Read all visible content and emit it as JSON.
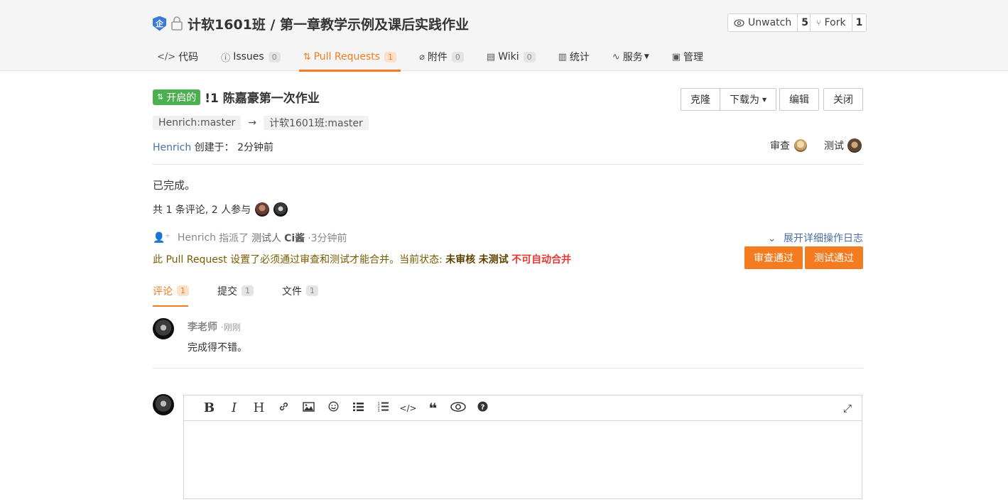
{
  "repo": {
    "badge": "企",
    "title": "计软1601班 / 第一章教学示例及课后实践作业",
    "watch": {
      "label": "Unwatch",
      "count": "5"
    },
    "fork": {
      "label": "Fork",
      "count": "1"
    }
  },
  "tabs": [
    {
      "label": "代码",
      "icon": "code-icon",
      "count": null
    },
    {
      "label": "Issues",
      "icon": "issue-icon",
      "count": "0"
    },
    {
      "label": "Pull Requests",
      "icon": "pull-request-icon",
      "count": "1"
    },
    {
      "label": "附件",
      "icon": "paperclip-icon",
      "count": "0"
    },
    {
      "label": "Wiki",
      "icon": "book-icon",
      "count": "0"
    },
    {
      "label": "统计",
      "icon": "bar-chart-icon",
      "count": null
    },
    {
      "label": "服务",
      "icon": "pulse-icon",
      "count": null
    },
    {
      "label": "管理",
      "icon": "settings-doc-icon",
      "count": null
    }
  ],
  "pr": {
    "state": "开启的",
    "title": "!1 陈嘉豪第一次作业",
    "source_branch": "Henrich:master",
    "target_branch": "计软1601班:master",
    "author": "Henrich",
    "created_label": "创建于：",
    "created_time": "2分钟前",
    "actions": {
      "clone": "克隆",
      "download": "下载为",
      "edit": "编辑",
      "close": "关闭"
    },
    "reviewer_label": "审查",
    "tester_label": "测试",
    "body": "已完成。",
    "participants": "共 1 条评论, 2 人参与",
    "activity": {
      "actor": "Henrich",
      "verb": "指派了",
      "role": "测试人",
      "target": "Ci酱",
      "time": "·3分钟前"
    },
    "expand_log": "展开详细操作日志",
    "notice": {
      "text": "此 Pull Request 设置了必须通过审查和测试才能合并。当前状态:",
      "status1": "未审核",
      "status2": "未测试",
      "status3": "不可自动合并"
    },
    "approve_review": "审查通过",
    "approve_test": "测试通过"
  },
  "comment_tabs": [
    {
      "label": "评论",
      "count": "1"
    },
    {
      "label": "提交",
      "count": "1"
    },
    {
      "label": "文件",
      "count": "1"
    }
  ],
  "comments": [
    {
      "author": "李老师",
      "time": "·刚刚",
      "text": "完成得不错。"
    }
  ],
  "editor": {
    "toolbar": [
      "bold-icon",
      "italic-icon",
      "heading-icon",
      "link-icon",
      "image-icon",
      "emoji-icon",
      "unordered-list-icon",
      "ordered-list-icon",
      "code-icon",
      "quote-icon",
      "preview-icon",
      "help-icon"
    ],
    "toolbar_glyphs": {
      "bold": "B",
      "italic": "I",
      "heading": "H"
    }
  },
  "colors": {
    "accent": "#f47b20",
    "open_state": "#4caf50",
    "link": "#4a6fa5",
    "danger": "#e53935"
  }
}
